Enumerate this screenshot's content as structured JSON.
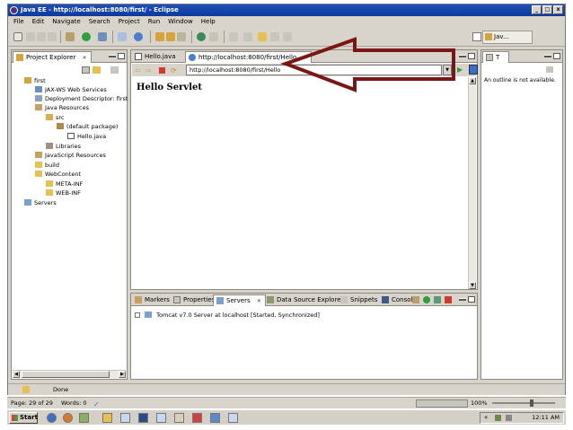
{
  "window": {
    "title": "Java EE - http://localhost:8080/first/ - Eclipse"
  },
  "menu": [
    "File",
    "Edit",
    "Navigate",
    "Search",
    "Project",
    "Run",
    "Window",
    "Help"
  ],
  "perspective": {
    "label": "Jav..."
  },
  "project_explorer": {
    "tab_label": "Project Explorer",
    "items": [
      {
        "label": "first",
        "icon": "project-icon"
      },
      {
        "label": "JAX-WS Web Services",
        "icon": "webservices-icon"
      },
      {
        "label": "Deployment Descriptor: first",
        "icon": "descriptor-icon"
      },
      {
        "label": "Java Resources",
        "icon": "java-resources-icon"
      },
      {
        "label": "src",
        "icon": "source-folder-icon"
      },
      {
        "label": "(default package)",
        "icon": "package-icon"
      },
      {
        "label": "Hello.java",
        "icon": "java-file-icon"
      },
      {
        "label": "Libraries",
        "icon": "libraries-icon"
      },
      {
        "label": "JavaScript Resources",
        "icon": "js-resources-icon"
      },
      {
        "label": "build",
        "icon": "folder-icon"
      },
      {
        "label": "WebContent",
        "icon": "folder-icon"
      },
      {
        "label": "META-INF",
        "icon": "folder-icon"
      },
      {
        "label": "WEB-INF",
        "icon": "folder-icon"
      },
      {
        "label": "Servers",
        "icon": "servers-folder-icon"
      }
    ]
  },
  "editor": {
    "tabs": [
      {
        "label": "Hello.java",
        "active": false
      },
      {
        "label": "http://localhost:8080/first/Hello",
        "active": true
      }
    ],
    "url": "http://localhost:8080/first/Hello",
    "page_heading": "Hello Servlet"
  },
  "outline": {
    "message": "An outline is not available."
  },
  "bottom_panel": {
    "tabs": [
      {
        "label": "Markers",
        "active": false
      },
      {
        "label": "Properties",
        "active": false
      },
      {
        "label": "Servers",
        "active": true
      },
      {
        "label": "Data Source Explorer",
        "active": false
      },
      {
        "label": "Snippets",
        "active": false
      },
      {
        "label": "Console",
        "active": false
      }
    ],
    "server_row": "Tomcat v7.0 Server at localhost  [Started, Synchronized]"
  },
  "status": {
    "done": "Done",
    "page": "Page: 29 of 29",
    "words": "Words: 0",
    "zoom": "100%"
  },
  "taskbar": {
    "start_label": "Start",
    "clock": "12:11 AM"
  },
  "annotation": {
    "arrow_color": "#7b1616"
  }
}
